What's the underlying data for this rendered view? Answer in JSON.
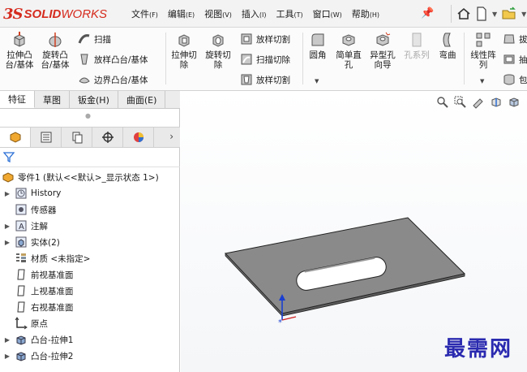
{
  "app": {
    "brand_ds": "3S",
    "brand_solid": "SOLID",
    "brand_works": "WORKS"
  },
  "menu": [
    {
      "label": "文件",
      "acc": "(F)"
    },
    {
      "label": "编辑",
      "acc": "(E)"
    },
    {
      "label": "视图",
      "acc": "(V)"
    },
    {
      "label": "插入",
      "acc": "(I)"
    },
    {
      "label": "工具",
      "acc": "(T)"
    },
    {
      "label": "窗口",
      "acc": "(W)"
    },
    {
      "label": "帮助",
      "acc": "(H)"
    }
  ],
  "commands": {
    "extrude_boss": "拉伸凸\n台/基体",
    "revolve_boss": "旋转凸\n台/基体",
    "sweep": "扫描",
    "loft_boss": "放样凸台/基体",
    "boundary_boss": "边界凸台/基体",
    "extrude_cut": "拉伸切\n除",
    "revolve_cut": "旋转切\n除",
    "loft_cut_top": "放样切割",
    "swept_cut": "扫描切除",
    "loft_cut_bottom": "放样切割",
    "fillet": "圆角",
    "simple_hole": "简单直\n孔",
    "hole_wizard": "异型孔\n向导",
    "hole_series": "孔系列",
    "flex": "弯曲",
    "linear_pattern": "线性阵\n列",
    "truncated_1": "拔",
    "truncated_2": "抽",
    "truncated_3": "包"
  },
  "tabs": [
    {
      "label": "特征",
      "active": true
    },
    {
      "label": "草图",
      "active": false
    },
    {
      "label": "钣金(H)",
      "active": false
    },
    {
      "label": "曲面(E)",
      "active": false
    }
  ],
  "tree": {
    "root": "零件1 (默认<<默认>_显示状态 1>)",
    "items": [
      {
        "label": "History",
        "expandable": true
      },
      {
        "label": "传感器",
        "expandable": false
      },
      {
        "label": "注解",
        "expandable": true
      },
      {
        "label": "实体(2)",
        "expandable": true
      },
      {
        "label": "材质 <未指定>",
        "expandable": false
      },
      {
        "label": "前视基准面",
        "expandable": false
      },
      {
        "label": "上视基准面",
        "expandable": false
      },
      {
        "label": "右视基准面",
        "expandable": false
      },
      {
        "label": "原点",
        "expandable": false
      },
      {
        "label": "凸台-拉伸1",
        "expandable": true
      },
      {
        "label": "凸台-拉伸2",
        "expandable": true
      }
    ]
  },
  "viewport": {
    "watermark": "最需网"
  },
  "colors": {
    "brand_red": "#d52b1e",
    "plate": "#8a8a8a",
    "accent_blue": "#2a6fd6",
    "watermark": "#2a2ab0"
  }
}
